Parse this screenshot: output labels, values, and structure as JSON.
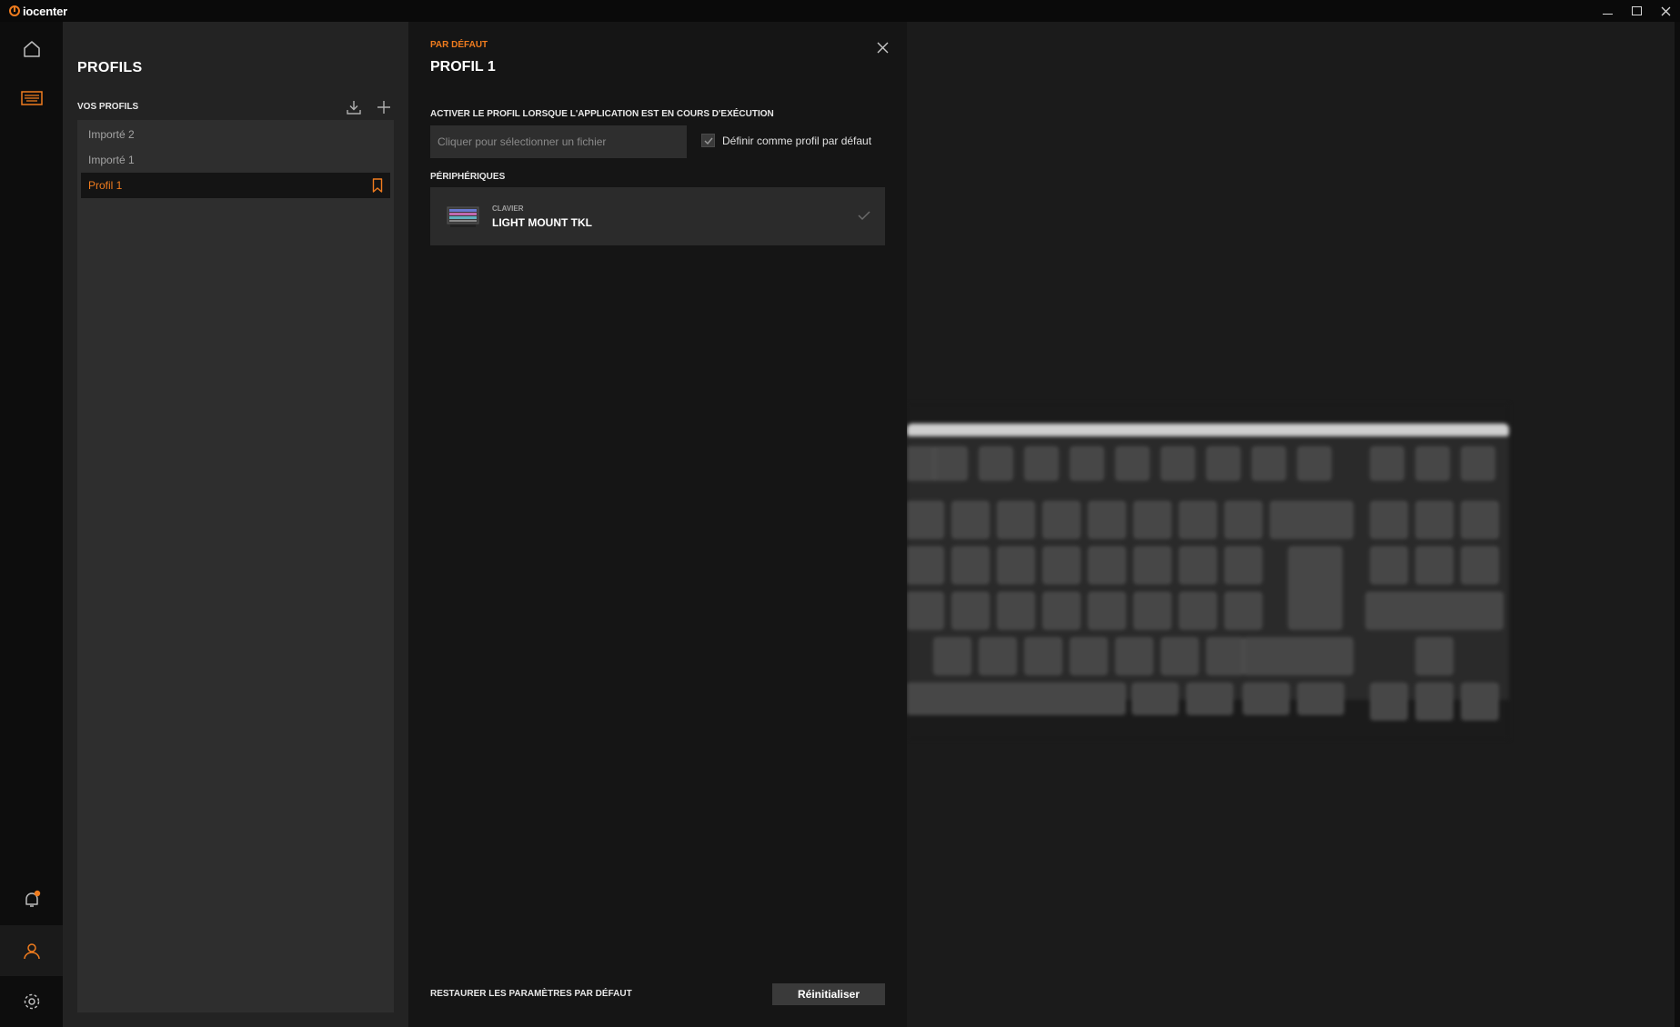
{
  "app": {
    "name": "iocenter",
    "accent": "#f07c1e"
  },
  "window_controls": [
    "minimize",
    "maximize",
    "close"
  ],
  "rail": {
    "top_icons": [
      "home-icon",
      "keyboard-icon"
    ],
    "bottom_icons": [
      "bell-icon",
      "user-icon",
      "gear-icon"
    ]
  },
  "profiles": {
    "title": "PROFILS",
    "section_label": "VOS PROFILS",
    "items": [
      {
        "label": "Importé 2",
        "selected": false
      },
      {
        "label": "Importé 1",
        "selected": false
      },
      {
        "label": "Profil 1",
        "selected": true
      }
    ]
  },
  "detail": {
    "default_tag": "PAR DÉFAUT",
    "profile_name": "PROFIL 1",
    "activate_label": "ACTIVER LE PROFIL LORSQUE L'APPLICATION EST EN COURS D'EXÉCUTION",
    "file_placeholder": "Cliquer pour sélectionner un fichier",
    "default_checkbox_label": "Définir comme profil par défaut",
    "default_checked": true,
    "devices_label": "PÉRIPHÉRIQUES",
    "device": {
      "type": "CLAVIER",
      "name": "LIGHT MOUNT TKL"
    },
    "restore_label": "RESTAURER LES PARAMÈTRES PAR DÉFAUT",
    "reset_button": "Réinitialiser"
  }
}
